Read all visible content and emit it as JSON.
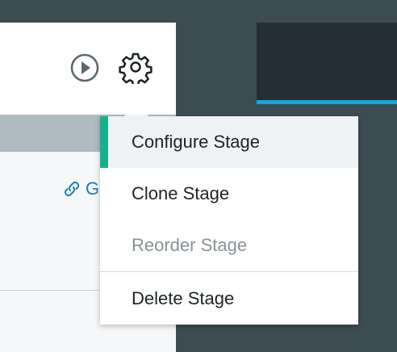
{
  "stage": {
    "link_text": "G"
  },
  "menu": {
    "items": [
      {
        "label": "Configure Stage",
        "state": "active"
      },
      {
        "label": "Clone Stage",
        "state": "enabled"
      },
      {
        "label": "Reorder Stage",
        "state": "disabled"
      },
      {
        "label": "Delete Stage",
        "state": "enabled"
      }
    ]
  },
  "icons": {
    "run": "play-circle-icon",
    "settings": "gear-icon",
    "link": "link-icon"
  },
  "colors": {
    "active_accent": "#17b08b",
    "link": "#1783a6",
    "tab_accent": "#16a8d3"
  }
}
